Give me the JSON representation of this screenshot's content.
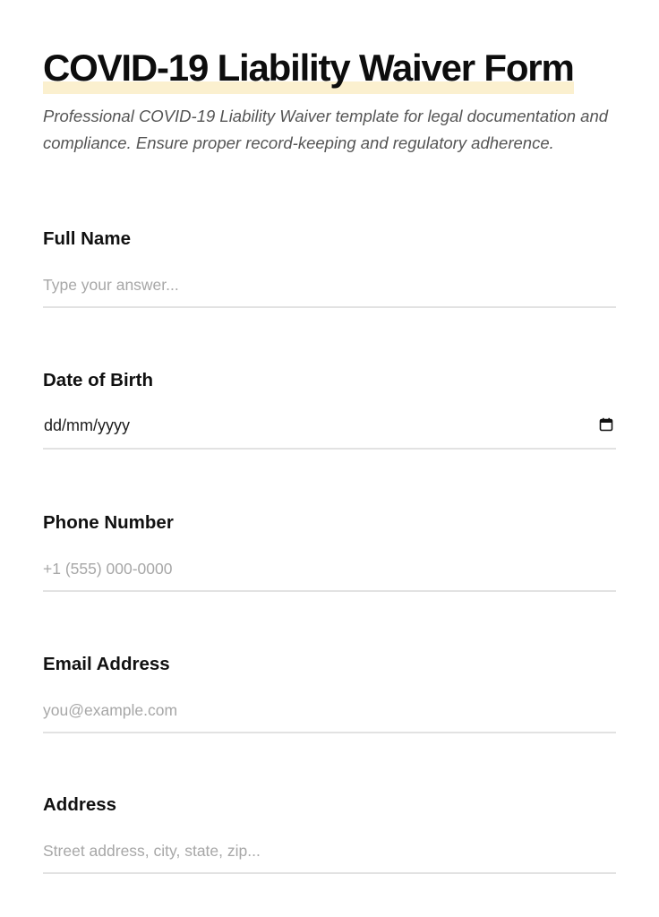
{
  "header": {
    "title": "COVID-19 Liability Waiver Form",
    "subtitle": "Professional COVID-19 Liability Waiver template for legal documentation and compliance. Ensure proper record-keeping and regulatory adherence."
  },
  "fields": {
    "full_name": {
      "label": "Full Name",
      "placeholder": "Type your answer...",
      "value": ""
    },
    "date_of_birth": {
      "label": "Date of Birth",
      "display": "dd/mm/yyyy",
      "icon": "calendar-icon"
    },
    "phone": {
      "label": "Phone Number",
      "placeholder": "+1 (555) 000-0000",
      "value": ""
    },
    "email": {
      "label": "Email Address",
      "placeholder": "you@example.com",
      "value": ""
    },
    "address": {
      "label": "Address",
      "placeholder": "Street address, city, state, zip...",
      "value": ""
    }
  },
  "colors": {
    "title_highlight": "#fbf0cf",
    "divider": "#e2e2e2",
    "placeholder": "#a7a7a7",
    "subtitle": "#555555"
  }
}
